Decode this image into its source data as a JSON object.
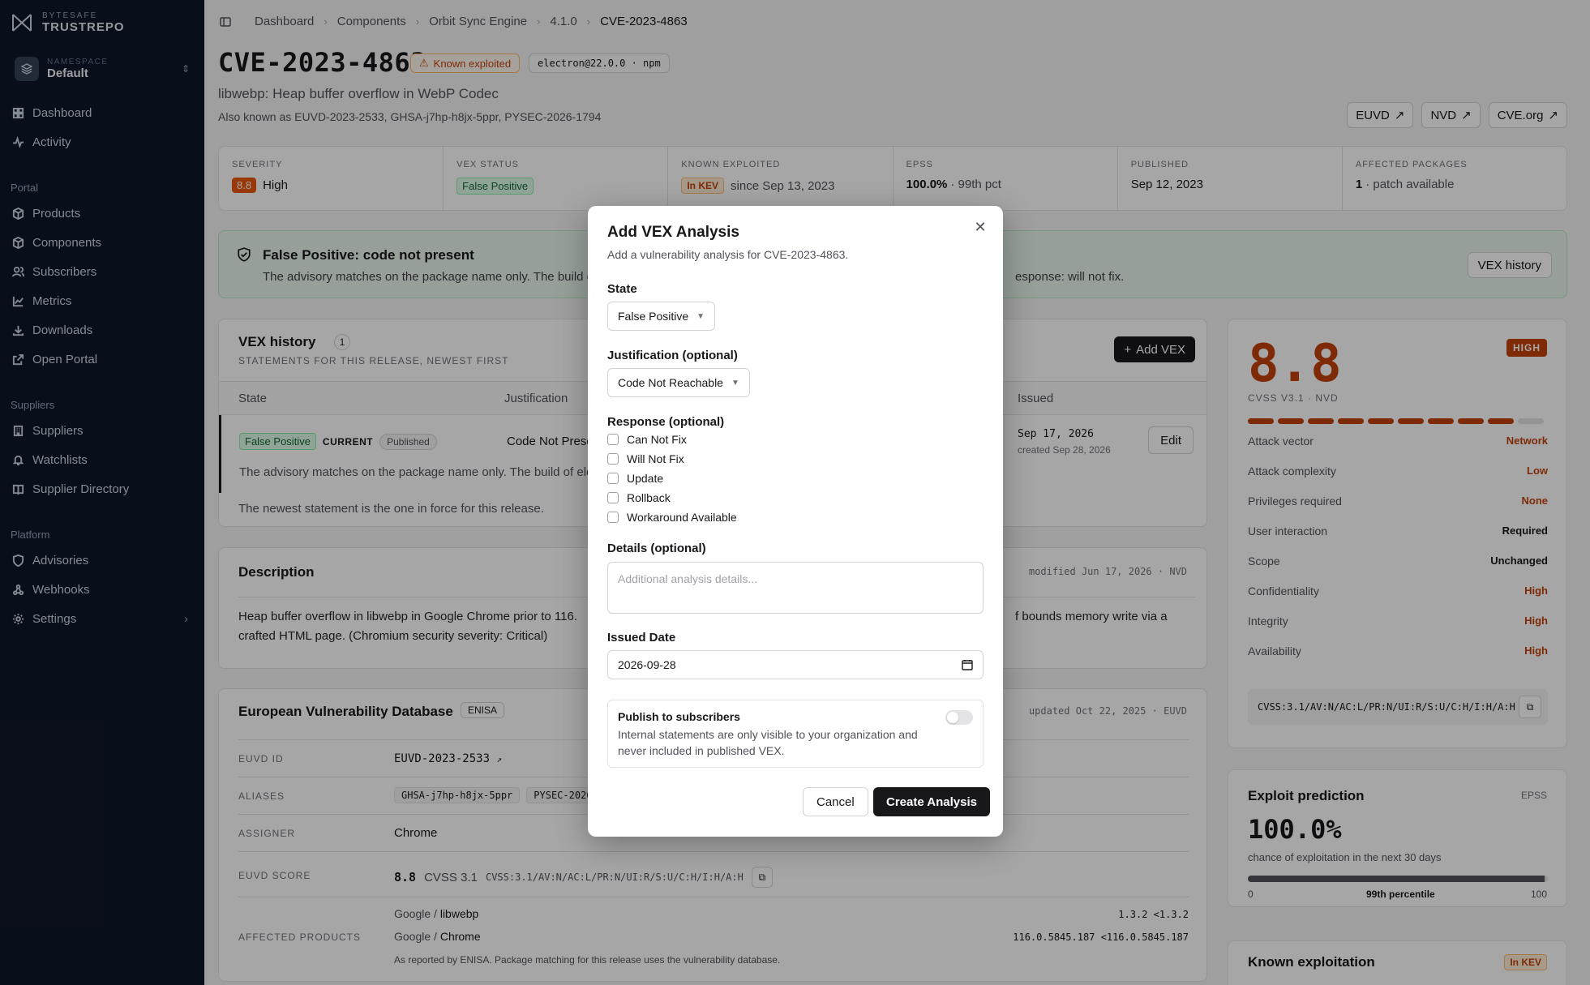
{
  "brand": {
    "top": "BYTESAFE",
    "name": "TRUSTREPO"
  },
  "namespace": {
    "label": "NAMESPACE",
    "value": "Default"
  },
  "nav": {
    "top": [
      "Dashboard",
      "Activity"
    ],
    "portal_label": "Portal",
    "portal": [
      "Products",
      "Components",
      "Subscribers",
      "Metrics",
      "Downloads",
      "Open Portal"
    ],
    "suppliers_label": "Suppliers",
    "suppliers": [
      "Suppliers",
      "Watchlists",
      "Supplier Directory"
    ],
    "platform_label": "Platform",
    "platform": [
      "Advisories",
      "Webhooks",
      "Settings"
    ]
  },
  "breadcrumb": [
    "Dashboard",
    "Components",
    "Orbit Sync Engine",
    "4.1.0",
    "CVE-2023-4863"
  ],
  "header": {
    "title": "CVE-2023-4863",
    "exploited_badge": "Known exploited",
    "package_badge": "electron@22.0.0 · npm",
    "subtitle": "libwebp: Heap buffer overflow in WebP Codec",
    "aka": "Also known as EUVD-2023-2533, GHSA-j7hp-h8jx-5ppr, PYSEC-2026-1794",
    "links": [
      "EUVD",
      "NVD",
      "CVE.org"
    ]
  },
  "stats": {
    "severity": {
      "label": "SEVERITY",
      "score": "8.8",
      "text": "High"
    },
    "vex": {
      "label": "VEX STATUS",
      "chip": "False Positive"
    },
    "kev": {
      "label": "KNOWN EXPLOITED",
      "chip": "In KEV",
      "text": "since Sep 13, 2023"
    },
    "epss": {
      "label": "EPSS",
      "value": "100.0%",
      "text": "· 99th pct"
    },
    "published": {
      "label": "PUBLISHED",
      "value": "Sep 12, 2023"
    },
    "affected": {
      "label": "AFFECTED PACKAGES",
      "value": "1",
      "text": "· patch available"
    }
  },
  "banner": {
    "title": "False Positive: code not present",
    "body": "The advisory matches on the package name only. The build of",
    "body_tail": "esponse: will not fix.",
    "button": "VEX history"
  },
  "vex_history": {
    "title": "VEX history",
    "count": "1",
    "subtitle": "STATEMENTS FOR THIS RELEASE, NEWEST FIRST",
    "add_button": "Add VEX",
    "columns": [
      "State",
      "Justification",
      "Issued"
    ],
    "row": {
      "state": "False Positive",
      "current": "CURRENT",
      "published": "Published",
      "justification": "Code Not Prese",
      "issued": "Sep 17, 2026",
      "created": "created Sep 28, 2026",
      "note": "The advisory matches on the package name only. The build of elec",
      "edit": "Edit"
    },
    "footer": "The newest statement is the one in force for this release."
  },
  "description": {
    "title": "Description",
    "meta": "modified Jun 17, 2026 · NVD",
    "body_a": "Heap buffer overflow in libwebp in Google Chrome prior to 116.",
    "body_b": "f bounds memory write via a",
    "body_c": "crafted HTML page. (Chromium security severity: Critical)"
  },
  "euvd": {
    "title": "European Vulnerability Database",
    "tag": "ENISA",
    "meta": "updated Oct 22, 2025 · EUVD",
    "id_label": "EUVD ID",
    "id_value": "EUVD-2023-2533",
    "aliases_label": "ALIASES",
    "aliases": [
      "GHSA-j7hp-h8jx-5ppr",
      "PYSEC-2026"
    ],
    "assigner_label": "ASSIGNER",
    "assigner": "Chrome",
    "score_label": "EUVD SCORE",
    "score": "8.8",
    "score_ver": "CVSS 3.1",
    "score_vec": "CVSS:3.1/AV:N/AC:L/PR:N/UI:R/S:U/C:H/I:H/A:H",
    "products_label": "AFFECTED PRODUCTS",
    "products": [
      {
        "vendor": "Google /",
        "name": "libwebp",
        "range": "1.3.2 <1.3.2"
      },
      {
        "vendor": "Google /",
        "name": "Chrome",
        "range": "116.0.5845.187 <116.0.5845.187"
      }
    ],
    "note": "As reported by ENISA. Package matching for this release uses the vulnerability database."
  },
  "cvss": {
    "score": "8.8",
    "rating": "HIGH",
    "label": "CVSS V3.1 · NVD",
    "filled_segments": 9,
    "total_segments": 10,
    "metrics": [
      {
        "k": "Attack vector",
        "v": "Network",
        "c": "#c2410c"
      },
      {
        "k": "Attack complexity",
        "v": "Low",
        "c": "#c2410c"
      },
      {
        "k": "Privileges required",
        "v": "None",
        "c": "#c2410c"
      },
      {
        "k": "User interaction",
        "v": "Required",
        "c": "#18181b"
      },
      {
        "k": "Scope",
        "v": "Unchanged",
        "c": "#18181b"
      },
      {
        "k": "Confidentiality",
        "v": "High",
        "c": "#c2410c"
      },
      {
        "k": "Integrity",
        "v": "High",
        "c": "#c2410c"
      },
      {
        "k": "Availability",
        "v": "High",
        "c": "#c2410c"
      }
    ],
    "vector": "CVSS:3.1/AV:N/AC:L/PR:N/UI:R/S:U/C:H/I:H/A:H"
  },
  "exploit": {
    "title": "Exploit prediction",
    "tag": "EPSS",
    "value": "100.0%",
    "desc": "chance of exploitation in the next 30 days",
    "fill_fraction": 0.99,
    "min": "0",
    "mid": "99th percentile",
    "max": "100"
  },
  "known_exploitation": {
    "title": "Known exploitation",
    "chip": "In KEV"
  },
  "modal": {
    "title": "Add VEX Analysis",
    "subtitle": "Add a vulnerability analysis for CVE-2023-4863.",
    "state_label": "State",
    "state_value": "False Positive",
    "just_label": "Justification (optional)",
    "just_value": "Code Not Reachable",
    "response_label": "Response (optional)",
    "responses": [
      "Can Not Fix",
      "Will Not Fix",
      "Update",
      "Rollback",
      "Workaround Available"
    ],
    "details_label": "Details (optional)",
    "details_placeholder": "Additional analysis details...",
    "date_label": "Issued Date",
    "date_value": "2026-09-28",
    "publish_title": "Publish to subscribers",
    "publish_desc": "Internal statements are only visible to your organization and never included in published VEX.",
    "cancel": "Cancel",
    "create": "Create Analysis"
  }
}
